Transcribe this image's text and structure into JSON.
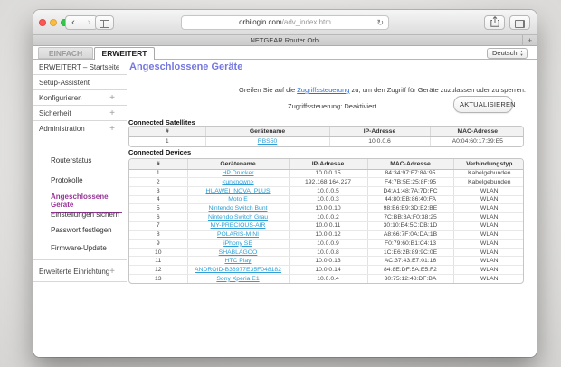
{
  "browser": {
    "url_host": "orbilogin.com",
    "url_path": "/adv_index.htm",
    "tab_title": "NETGEAR Router Orbi",
    "new_tab": "+"
  },
  "router_tabs": [
    {
      "label": "EINFACH",
      "active": false
    },
    {
      "label": "ERWEITERT",
      "active": true
    }
  ],
  "language_select": {
    "value": "Deutsch"
  },
  "sidebar": {
    "items": [
      {
        "label": "ERWEITERT – Startseite",
        "plus": false
      },
      {
        "label": "Setup-Assistent",
        "plus": false
      },
      {
        "label": "Konfigurieren",
        "plus": true
      },
      {
        "label": "Sicherheit",
        "plus": true
      },
      {
        "label": "Administration",
        "plus": true
      }
    ],
    "admin_children": [
      {
        "label": "Routerstatus",
        "active": false
      },
      {
        "label": "Protokolle",
        "active": false
      },
      {
        "label": "Angeschlossene Geräte",
        "active": true
      },
      {
        "label": "Einstellungen sichern",
        "active": false
      },
      {
        "label": "Passwort festlegen",
        "active": false
      },
      {
        "label": "Firmware-Update",
        "active": false
      }
    ],
    "bottom_item": {
      "label": "Erweiterte Einrichtung",
      "plus": true
    }
  },
  "main": {
    "title": "Angeschlossene Geräte",
    "note_prefix": "Greifen Sie auf die ",
    "note_link": "Zugriffssteuerung",
    "note_suffix": " zu, um den Zugriff für Geräte zuzulassen oder zu sperren.",
    "status": "Zugriffssteuerung: Deaktiviert",
    "refresh_button": "AKTUALISIEREN",
    "satellites": {
      "label": "Connected Satellites",
      "headers": [
        "#",
        "Gerätename",
        "IP-Adresse",
        "MAC-Adresse"
      ],
      "rows": [
        {
          "num": "1",
          "name": "RBS50",
          "ip": "10.0.0.6",
          "mac": "A0:04:60:17:39:E5"
        }
      ]
    },
    "devices": {
      "label": "Connected Devices",
      "headers": [
        "#",
        "Gerätename",
        "IP-Adresse",
        "MAC-Adresse",
        "Verbindungstyp"
      ],
      "rows": [
        {
          "num": "1",
          "name": "HP Drucker",
          "ip": "10.0.0.15",
          "mac": "84:34:97:F7:8A:95",
          "type": "Kabelgebunden"
        },
        {
          "num": "2",
          "name": "<unknown>",
          "ip": "192.168.164.227",
          "mac": "F4:7B:5E:25:8F:95",
          "type": "Kabelgebunden"
        },
        {
          "num": "3",
          "name": "HUAWEI_NOVA_PLUS",
          "ip": "10.0.0.5",
          "mac": "D4:A1:48:7A:7D:FC",
          "type": "WLAN"
        },
        {
          "num": "4",
          "name": "Moto E",
          "ip": "10.0.0.3",
          "mac": "44:80:EB:86:40:FA",
          "type": "WLAN"
        },
        {
          "num": "5",
          "name": "Nintendo Switch Bunt",
          "ip": "10.0.0.10",
          "mac": "98:B6:E9:3D:E2:BE",
          "type": "WLAN"
        },
        {
          "num": "6",
          "name": "Nintendo Switch Grau",
          "ip": "10.0.0.2",
          "mac": "7C:BB:8A:F0:38:25",
          "type": "WLAN"
        },
        {
          "num": "7",
          "name": "MY-PRECIOUS-AIR",
          "ip": "10.0.0.11",
          "mac": "30:10:E4:5C:DB:1D",
          "type": "WLAN"
        },
        {
          "num": "8",
          "name": "POLARIS-MINI",
          "ip": "10.0.0.12",
          "mac": "A8:66:7F:0A:DA:1B",
          "type": "WLAN"
        },
        {
          "num": "9",
          "name": "iPhony SE",
          "ip": "10.0.0.9",
          "mac": "F0:79:60:B1:C4:13",
          "type": "WLAN"
        },
        {
          "num": "10",
          "name": "SHABLAGOO",
          "ip": "10.0.0.8",
          "mac": "1C:E6:2B:89:9C:0E",
          "type": "WLAN"
        },
        {
          "num": "11",
          "name": "HTC Play",
          "ip": "10.0.0.13",
          "mac": "AC:37:43:E7:01:16",
          "type": "WLAN"
        },
        {
          "num": "12",
          "name": "ANDROID-B36977E35F048182",
          "ip": "10.0.0.14",
          "mac": "84:8E:DF:5A:E5:F2",
          "type": "WLAN"
        },
        {
          "num": "13",
          "name": "Sony Xperia E1",
          "ip": "10.0.0.4",
          "mac": "30:75:12:48:DF:BA",
          "type": "WLAN"
        }
      ]
    }
  },
  "colors": {
    "accent_purple": "#7477DF",
    "active_item_magenta": "#993399",
    "device_link_blue": "#2B9FD6",
    "note_link_blue": "#2970D6"
  }
}
